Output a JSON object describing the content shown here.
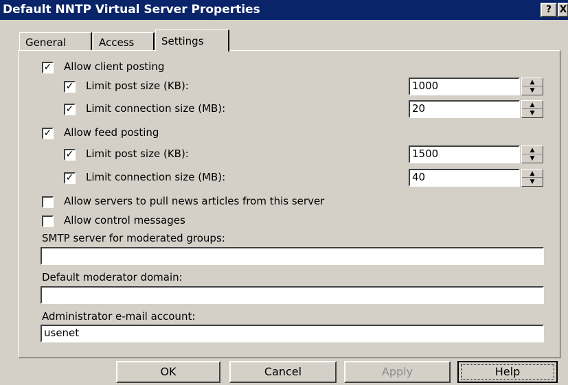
{
  "window": {
    "title": "Default NNTP Virtual Server Properties",
    "help_button": "?",
    "close_button": "X"
  },
  "tabs": [
    "General",
    "Access",
    "Settings"
  ],
  "settings": {
    "allow_client_posting": {
      "label": "Allow client posting",
      "checked": true
    },
    "client_limit_post": {
      "label": "Limit post size (KB):",
      "checked": true,
      "value": "1000"
    },
    "client_limit_conn": {
      "label": "Limit connection size (MB):",
      "checked": true,
      "value": "20"
    },
    "allow_feed_posting": {
      "label": "Allow feed posting",
      "checked": true
    },
    "feed_limit_post": {
      "label": "Limit post size (KB):",
      "checked": true,
      "value": "1500"
    },
    "feed_limit_conn": {
      "label": "Limit connection size (MB):",
      "checked": true,
      "value": "40"
    },
    "allow_pull": {
      "label": "Allow servers to pull news articles from this server",
      "checked": false
    },
    "allow_control": {
      "label": "Allow control messages",
      "checked": false
    },
    "smtp_label": "SMTP server for moderated groups:",
    "smtp_value": "",
    "moderator_label": "Default moderator domain:",
    "moderator_value": "",
    "admin_label": "Administrator e-mail account:",
    "admin_value": "usenet"
  },
  "buttons": {
    "ok": "OK",
    "cancel": "Cancel",
    "apply": "Apply",
    "help": "Help"
  },
  "glyphs": {
    "check": "✓",
    "spin_up": "▲",
    "spin_down": "▼"
  }
}
